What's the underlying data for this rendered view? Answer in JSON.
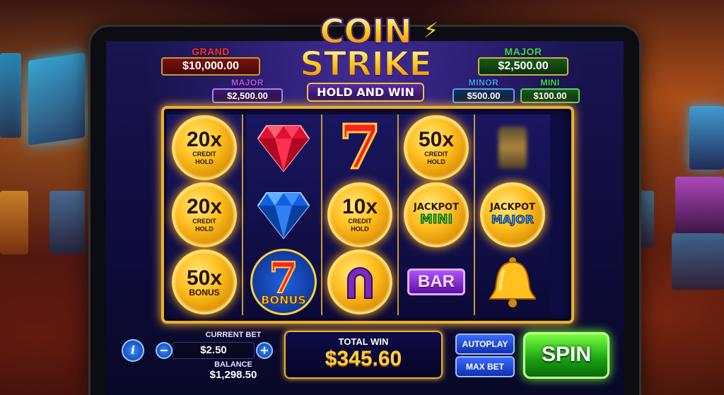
{
  "logo": {
    "line1": "COIN",
    "line2": "STRIKE",
    "subtitle": "HOLD AND WIN"
  },
  "jackpots": {
    "grand": {
      "label": "GRAND",
      "value": "$10,000.00"
    },
    "major_left": {
      "label": "MAJOR",
      "value": "$2,500.00"
    },
    "major_right": {
      "label": "MAJOR",
      "value": "$2,500.00"
    },
    "minor": {
      "label": "MINOR",
      "value": "$500.00"
    },
    "mini": {
      "label": "MINI",
      "value": "$100.00"
    }
  },
  "reels": [
    [
      {
        "type": "coin",
        "big": "20x",
        "l1": "CREDIT",
        "l2": "HOLD"
      },
      {
        "type": "coin",
        "big": "20x",
        "l1": "CREDIT",
        "l2": "HOLD"
      },
      {
        "type": "coin",
        "big": "50x",
        "l1": "BONUS",
        "l2": ""
      }
    ],
    [
      {
        "type": "red-gem"
      },
      {
        "type": "blue-gem"
      },
      {
        "type": "bonus-seven",
        "label": "BONUS"
      }
    ],
    [
      {
        "type": "seven"
      },
      {
        "type": "coin",
        "big": "10x",
        "l1": "CREDIT",
        "l2": "HOLD"
      },
      {
        "type": "horseshoe"
      }
    ],
    [
      {
        "type": "coin",
        "big": "50x",
        "l1": "CREDIT",
        "l2": "HOLD"
      },
      {
        "type": "jackpot-coin",
        "top": "JACKPOT",
        "name": "MINI"
      },
      {
        "type": "bar",
        "label": "BAR"
      }
    ],
    [
      {
        "type": "blur"
      },
      {
        "type": "jackpot-coin",
        "top": "JACKPOT",
        "name": "MAJOR"
      },
      {
        "type": "bell"
      }
    ]
  ],
  "controls": {
    "info_icon": "info-icon",
    "current_bet_label": "CURRENT BET",
    "current_bet_value": "$2.50",
    "minus": "−",
    "plus": "+",
    "balance_label": "BALANCE",
    "balance_value": "$1,298.50",
    "total_win_label": "TOTAL WIN",
    "total_win_value": "$345.60",
    "autoplay_label": "AUTOPLAY",
    "maxbet_label": "MAX BET",
    "spin_label": "SPIN"
  }
}
